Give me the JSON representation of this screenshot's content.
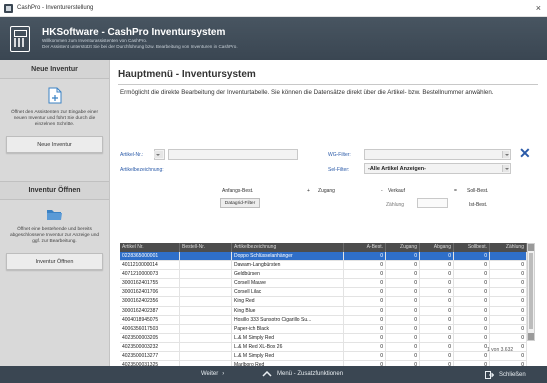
{
  "window": {
    "title": "CashPro - Inventurerstellung",
    "close_glyph": "×"
  },
  "header": {
    "title": "HKSoftware - CashPro Inventursystem",
    "subtitle_line1": "Willkommen zum Inventurassistenten von CashPro.",
    "subtitle_line2": "Der Assistent unterstützt Sie bei der Durchführung bzw. Bearbeitung von Inventuren in CashPro."
  },
  "sidebar": {
    "new": {
      "title": "Neue Inventur",
      "icon": "new-document-icon",
      "description": "Öffnet den Assistenten zur Eingabe einer neuen Inventur und führt Sie durch die einzelnen Schritte.",
      "button_label": "Neue Inventur"
    },
    "open": {
      "title": "Inventur Öffnen",
      "icon": "folder-icon",
      "description": "Öffnet eine bestehende und bereits abgeschlossene Inventur zur Anzeige und ggf. zur Bearbeitung.",
      "button_label": "Inventur Öffnen"
    }
  },
  "main": {
    "title": "Hauptmenü - Inventursystem",
    "description": "Ermöglicht die direkte Bearbeitung der Inventurtabelle. Sie können die Datensätze direkt über die Artikel- bzw. Bestellnummer anwählen.",
    "filters": {
      "artikel_nr_label": "Artikel-Nr.:",
      "artikel_bez_label": "Artikelbezeichnung:",
      "wg_filter_label": "WG-Filter:",
      "sel_filter_label": "Sel-Filter:",
      "sel_filter_value": "-Alle Artikel Anzeigen-"
    },
    "legend": {
      "anfangs": "Anfangs-Best.",
      "plus": "+",
      "zugang": "Zugang",
      "minus": "-",
      "verkauf": "Verkauf",
      "equals": "=",
      "soll": "Soll-Best.",
      "zaehlung": "Zählung",
      "ist": "Ist-Best."
    },
    "datagrid_filter_label": "Datagrid-Filter",
    "table": {
      "columns": [
        "Artikel Nr.",
        "Bestell-Nr.",
        "Artikelbezeichnung",
        "A-Best.",
        "Zugang",
        "Abgang",
        "Sollbest.",
        "Zählung"
      ],
      "rows": [
        [
          "0228365000001",
          "",
          "Doppo Schlüsselanhänger",
          "0",
          "0",
          "0",
          "0",
          ""
        ],
        [
          "4011210000014",
          "",
          "Dawam-Langbürsten",
          "0",
          "0",
          "0",
          "0",
          "0"
        ],
        [
          "4071210000073",
          "",
          "Geldbürsen",
          "0",
          "0",
          "0",
          "0",
          "0"
        ],
        [
          "3000162401755",
          "",
          "Corsell Mauve",
          "0",
          "0",
          "0",
          "0",
          "0"
        ],
        [
          "3000162401706",
          "",
          "Corsell Lilac",
          "0",
          "0",
          "0",
          "0",
          "0"
        ],
        [
          "3000162402356",
          "",
          "King Red",
          "0",
          "0",
          "0",
          "0",
          "0"
        ],
        [
          "3000162402387",
          "",
          "King Blue",
          "0",
          "0",
          "0",
          "0",
          "0"
        ],
        [
          "4004018945075",
          "",
          "Hosillo 333 Sunsotro Cigarillo Su...",
          "0",
          "0",
          "0",
          "0",
          "0"
        ],
        [
          "4006356017503",
          "",
          "Paper-ich Black",
          "0",
          "0",
          "0",
          "0",
          "0"
        ],
        [
          "4023500003205",
          "",
          "L.& M Simply Red",
          "0",
          "0",
          "0",
          "0",
          "0"
        ],
        [
          "4023500003232",
          "",
          "L.& M Red XL-Box 26",
          "0",
          "0",
          "0",
          "0",
          "0"
        ],
        [
          "4023500013277",
          "",
          "L.& M Simply Red",
          "0",
          "0",
          "0",
          "0",
          "0"
        ],
        [
          "4023500031325",
          "",
          "Marlboro Red",
          "0",
          "0",
          "0",
          "0",
          "0"
        ]
      ]
    },
    "record_count": "1 von 3.632"
  },
  "bottom": {
    "weiter": "Weiter",
    "menu": "Menü - Zusatzfunktionen",
    "close": "Schließen"
  },
  "colors": {
    "header_bg": "#3a4652",
    "selection": "#2f6fc9",
    "accent_blue": "#2a5aa8"
  }
}
